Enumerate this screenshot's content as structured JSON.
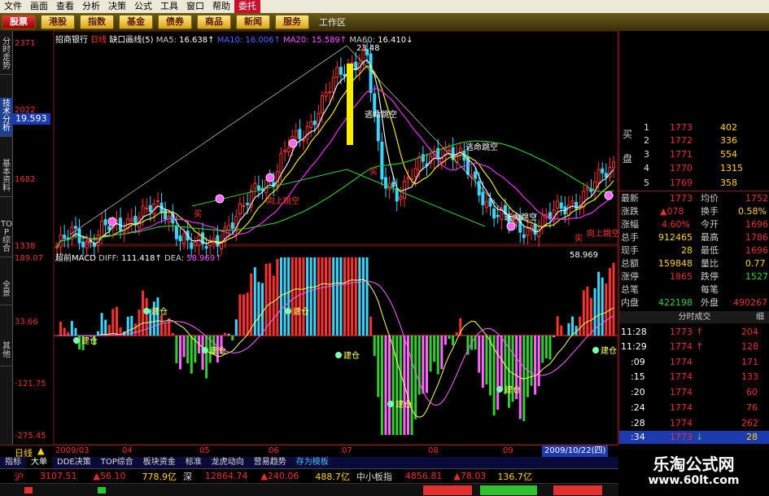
{
  "menu": [
    "文件",
    "画面",
    "查看",
    "分析",
    "决策",
    "公式",
    "工具",
    "窗口",
    "帮助",
    "委托"
  ],
  "toolbar": {
    "buttons": [
      "股票",
      "港股",
      "指数",
      "基金",
      "债券",
      "商品",
      "新闻",
      "服务"
    ],
    "workspace": "工作区"
  },
  "left_tabs": [
    "分时走势",
    "技术分析",
    "基本资料",
    "TOP综合",
    "全景",
    "其他"
  ],
  "chart": {
    "stock": "招商银行",
    "period": "日线",
    "indicator": "缺口画线(5)",
    "ma": [
      {
        "name": "MA5",
        "value": "16.638↑",
        "color": "#ffffff"
      },
      {
        "name": "MA10",
        "value": "16.006↑",
        "color": "#ffff00"
      },
      {
        "name": "MA20",
        "value": "15.589↑",
        "color": "#ff33ff"
      },
      {
        "name": "MA60",
        "value": "16.410↓",
        "color": "#33ff33"
      }
    ],
    "price_labels": [
      "2371",
      "2022",
      "1682",
      "1338"
    ],
    "price_tag": "19.593",
    "peak_label": "23.48",
    "annotations": {
      "buy": "买",
      "jump_up": "向上跳空",
      "escape_gap": "逃命跳空"
    },
    "macd": {
      "name": "超前MACD",
      "diff_label": "DIFF:",
      "diff": "111.418↑",
      "dea_label": "DEA:",
      "dea": "58.969↑",
      "right_value": "58.969",
      "labels": [
        "189.07",
        "33.66",
        "-121.75",
        "-275.45"
      ],
      "build_pos": "建仓"
    },
    "date_ticks": [
      "2009/03",
      "04",
      "05",
      "06",
      "07",
      "08",
      "09"
    ],
    "date_current": "2009/10/22(四)",
    "period_label": "日线"
  },
  "chart_data": {
    "type": "candlestick",
    "price_axis": {
      "labels": [
        2371,
        2022,
        1682,
        1338
      ]
    },
    "macd_axis": {
      "labels": [
        189.07,
        33.66,
        -121.75,
        -275.45
      ]
    },
    "close_path": [
      12.9,
      13.6,
      13.1,
      14.0,
      13.8,
      14.6,
      15.0,
      14.6,
      13.6,
      12.9,
      13.0,
      14.0,
      14.8,
      16.2,
      16.6,
      18.3,
      19.0,
      20.4,
      21.8,
      22.6,
      23.4,
      16.4,
      15.8,
      16.9,
      17.4,
      18.2,
      17.8,
      16.2,
      15.1,
      14.4,
      13.7,
      14.1,
      14.6,
      15.0,
      15.7,
      16.4,
      17.2
    ]
  },
  "orderbook": {
    "buy_header": "买盘",
    "rows": [
      {
        "n": "1",
        "price": "1773",
        "vol": "402"
      },
      {
        "n": "2",
        "price": "1772",
        "vol": "336"
      },
      {
        "n": "3",
        "price": "1771",
        "vol": "554"
      },
      {
        "n": "4",
        "price": "1770",
        "vol": "1315"
      },
      {
        "n": "5",
        "price": "1769",
        "vol": "358"
      }
    ]
  },
  "quote": [
    {
      "l": "最新",
      "v": "1773",
      "l2": "均价",
      "v2": "1752"
    },
    {
      "l": "涨跌",
      "v": "▲078",
      "l2": "换手",
      "v2": "0.58%"
    },
    {
      "l": "涨幅",
      "v": "4.60%",
      "l2": "今开",
      "v2": "1696"
    },
    {
      "l": "总手",
      "v": "912465",
      "l2": "最高",
      "v2": "1786"
    },
    {
      "l": "现手",
      "v": "28",
      "l2": "最低",
      "v2": "1696"
    },
    {
      "l": "总额",
      "v": "159848",
      "l2": "量比",
      "v2": "0.77"
    },
    {
      "l": "涨停",
      "v": "1865",
      "l2": "跌停",
      "v2": "1527"
    },
    {
      "l": "总笔",
      "v": "",
      "l2": "每笔",
      "v2": ""
    },
    {
      "l": "内盘",
      "v": "422198",
      "l2": "外盘",
      "v2": "490267"
    }
  ],
  "ticks": {
    "header": "分时成交",
    "header_btn": "细",
    "rows": [
      {
        "t": "11:28",
        "p": "1773",
        "a": "↑",
        "v": "204"
      },
      {
        "t": "11:29",
        "p": "1774",
        "a": "↑",
        "v": "128"
      },
      {
        "t": ":09",
        "p": "1774",
        "a": "",
        "v": "171"
      },
      {
        "t": ":15",
        "p": "1774",
        "a": "",
        "v": "133"
      },
      {
        "t": ":20",
        "p": "1774",
        "a": "",
        "v": "60"
      },
      {
        "t": ":24",
        "p": "1774",
        "a": "",
        "v": "76"
      },
      {
        "t": ":28",
        "p": "1774",
        "a": "",
        "v": "262"
      },
      {
        "t": ":34",
        "p": "1773",
        "a": "↓",
        "v": "28"
      }
    ]
  },
  "bottom_tabs": [
    "指标",
    "大单",
    "DDE决策",
    "TOP综合",
    "板块资金",
    "标准",
    "龙虎动向",
    "营易趋势",
    "存为模板"
  ],
  "ticker": {
    "sh": "沪",
    "sh_val": "3107.51",
    "sh_chg": "▲56.10",
    "sh_amt": "778.9亿",
    "sz": "深",
    "sz_val": "12864.74",
    "sz_chg": "▲240.06",
    "sz_amt": "488.7亿",
    "sme": "中小板指",
    "sme_val": "4856.81",
    "sme_chg": "▲78.03",
    "sme_amt": "136.7亿"
  },
  "brand": {
    "title": "乐淘公式网",
    "url": "www.60lt.com"
  }
}
